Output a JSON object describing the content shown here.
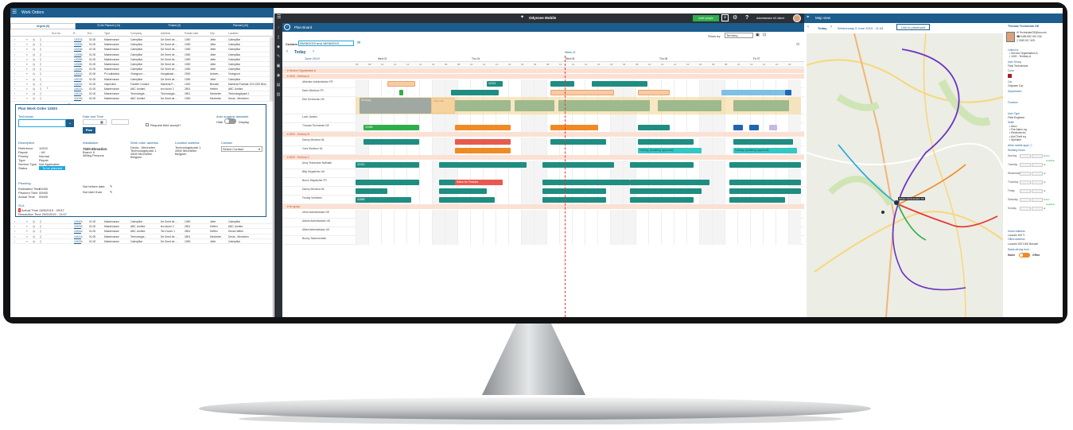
{
  "workorders": {
    "title": "Work Orders",
    "tabs": [
      "Urgent (0)",
      "To Be Planned (14)",
      "Posted (0)",
      "Planned (44)"
    ],
    "headers": [
      "SLA ris...",
      "R...",
      "Est...",
      "Type",
      "Company",
      "Address",
      "Postal code",
      "City",
      "Location"
    ],
    "rows_top": [
      {
        "id": "12021",
        "n": "1",
        "est": "01:00",
        "type": "Maintenance",
        "company": "Caterpillar",
        "address": "De Smet de ...",
        "postal": "1090",
        "city": "Jette",
        "location": "Caterpillar"
      },
      {
        "id": "12023",
        "n": "1",
        "est": "01:00",
        "type": "Maintenance",
        "company": "Caterpillar",
        "address": "De Smet de ...",
        "postal": "1090",
        "city": "Jette",
        "location": "Caterpillar"
      },
      {
        "id": "12024",
        "n": "1",
        "est": "01:00",
        "type": "Maintenance",
        "company": "Caterpillar",
        "address": "De Smet de ...",
        "postal": "1090",
        "city": "Jette",
        "location": "Caterpillar"
      },
      {
        "id": "12025",
        "n": "1",
        "est": "01:00",
        "type": "Maintenance",
        "company": "Caterpillar",
        "address": "De Smet de ...",
        "postal": "1090",
        "city": "Jette",
        "location": "Caterpillar"
      },
      {
        "id": "12026",
        "n": "1",
        "est": "01:00",
        "type": "Maintenance",
        "company": "Caterpillar",
        "address": "De Smet de ...",
        "postal": "1090",
        "city": "Jette",
        "location": "Caterpillar"
      },
      {
        "id": "12028",
        "n": "1",
        "est": "01:00",
        "type": "Maintenance",
        "company": "Caterpillar",
        "address": "De Smet de ...",
        "postal": "1090",
        "city": "Jette",
        "location": "Caterpillar"
      },
      {
        "id": "12029",
        "n": "1",
        "est": "01:00",
        "type": "Maintenance",
        "company": "Caterpillar",
        "address": "De Smet de ...",
        "postal": "1090",
        "city": "Jette",
        "location": "Caterpillar"
      },
      {
        "id": "12031",
        "n": "1",
        "est": "01:00",
        "type": "PV-validation",
        "company": "Vloeigroot ...",
        "address": "Hoogstraat ...",
        "postal": "2000",
        "city": "Antwer...",
        "location": "Vloeigroot"
      },
      {
        "id": "11923",
        "n": "1",
        "est": "01:00",
        "type": "Maintenance",
        "company": "Caterpillar",
        "address": "De Smet de ...",
        "postal": "1090",
        "city": "Jette",
        "location": "Caterpillar"
      },
      {
        "id": "11920",
        "n": "1",
        "est": "01:00",
        "type": "Inspection",
        "company": "Familie Cornard",
        "address": "Marnixla P...",
        "postal": "1000",
        "city": "Brussel",
        "location": "Marnixla Postrast 123 1000 Brus"
      },
      {
        "id": "11921",
        "n": "1",
        "est": "01:00",
        "type": "Maintenance",
        "company": "ABC Limited",
        "address": "ten doorn 2",
        "postal": "2801",
        "city": "Heffen",
        "location": "ABC Limited"
      },
      {
        "id": "11924",
        "n": "1",
        "est": "01:00",
        "type": "Maintenance",
        "company": "Technologie...",
        "address": "Technologie...",
        "postal": "2801",
        "city": "Mechelen",
        "location": "Technologiepark 1"
      },
      {
        "id": "11919",
        "n": "1",
        "est": "01:00",
        "type": "Maintenance",
        "company": "ABC Limited",
        "address": "De Smet de ...",
        "postal": "1090",
        "city": "Mechelen",
        "location": "Dexia - Mechelen"
      }
    ],
    "rows_bottom": [
      {
        "id": "11940",
        "n": "1",
        "est": "01:00",
        "type": "Maintenance",
        "company": "Caterpillar",
        "address": "De Smet de ...",
        "postal": "1090",
        "city": "Jette",
        "location": "Caterpillar"
      },
      {
        "id": "11943",
        "n": "1",
        "est": "01:00",
        "type": "Maintenance",
        "company": "ABC Limited",
        "address": "ten doorn 2",
        "postal": "2801",
        "city": "Heffen",
        "location": "ABC Limited"
      },
      {
        "id": "11944",
        "n": "1",
        "est": "01:00",
        "type": "Maintenance",
        "company": "ABC Limited",
        "address": "Ten Doorn 1",
        "postal": "2801",
        "city": "Heffen",
        "location": "Dexia Heffen"
      },
      {
        "id": "11941",
        "n": "1",
        "est": "01:00",
        "type": "Maintenance",
        "company": "Technologie...",
        "address": "De Smet de ...",
        "postal": "2801",
        "city": "Mechelen",
        "location": "Dexia - Mechelen"
      },
      {
        "id": "11933",
        "n": "1",
        "est": "01:00",
        "type": "Maintenance",
        "company": "Caterpillar",
        "address": "De Smet de ...",
        "postal": "1090",
        "city": "Jette",
        "location": "Caterpillar"
      }
    ],
    "plan": {
      "title": "Plan Work Order 11920",
      "technician_label": "Technician",
      "date_label": "Date and Time",
      "plan_button": "Plan",
      "request_accept": "Request field accept?",
      "auto_suggest": "Auto suggest assistant",
      "hide": "Hide",
      "display": "Display",
      "description": "Description",
      "fields": [
        {
          "k": "Reference",
          "v": "11920"
        },
        {
          "k": "Repair",
          "v": "- UK"
        },
        {
          "k": "Priority",
          "v": "Normal"
        },
        {
          "k": "Type",
          "v": "Repair"
        },
        {
          "k": "Service Type",
          "v": "Not Applicable"
        },
        {
          "k": "Status",
          "v": "To be planned"
        }
      ],
      "installation": "Installation",
      "installation_lines": [
        "7020 Elevation",
        "Brand: K",
        "489kg Persons"
      ],
      "wo_address": "Work order address",
      "wo_address_lines": [
        "Dexia - Mechelen",
        "Technologiepark 1",
        "2800 Mechelen",
        "Belgium"
      ],
      "loc_address": "Location address",
      "loc_address_lines": [
        "Technologiepark 1",
        "2800 Mechelen",
        "Belgium"
      ],
      "contact": "Contact",
      "contact_select": "Select Contact",
      "planning": "Planning",
      "planning_fields": [
        {
          "k": "Estimated Time",
          "v": "01h00"
        },
        {
          "k": "Planned Time",
          "v": "00h00"
        },
        {
          "k": "Actual Time",
          "v": "00h00"
        }
      ],
      "not_before": "Not before date",
      "not_later": "Not later than",
      "sla": "SLA",
      "sla_lines": [
        "Arrival Time  28/5/2019 - 09:57",
        "Resolution Time 29/5/2019 - 11:57"
      ]
    }
  },
  "odyssee": {
    "app_title": "Odyssee Mobile",
    "invite_button": "Invite people",
    "user": "Administrator UK Albert"
  },
  "planboard": {
    "title": "Plan Board",
    "show_by_label": "Show by",
    "show_by_value": "Territory",
    "custom_label": "Custom",
    "custom_range": "05/06/2019 and 18/06/2019",
    "today": "Today",
    "month": "June 2019",
    "week_label": "Week 21",
    "days": [
      "Wed 02",
      "Thu 04",
      "Wed 05",
      "Thu 06",
      "Fri 07"
    ],
    "hours": [
      "06",
      "08",
      "10",
      "12",
      "14",
      "16",
      "18",
      "06",
      "08",
      "10",
      "12",
      "14",
      "16",
      "18",
      "06",
      "08",
      "10",
      "12",
      "14",
      "16",
      "18",
      "06",
      "08",
      "10",
      "12",
      "14",
      "16",
      "18",
      "06",
      "08",
      "10",
      "12",
      "14",
      "16",
      "18"
    ],
    "groups": [
      {
        "label": "Service Organisation A",
        "rows": []
      },
      {
        "label": "1000 - Territory A",
        "rows": [
          "Albertine Administrator FR",
          "Dario Monteux FR",
          "Dirk Technician UK",
          "Ludo Jansen",
          "Thomas Technician DE"
        ]
      },
      {
        "label": "2000 - Territory B",
        "rows": [
          "Danny Monteux NL",
          "Yves Monteux NL"
        ]
      },
      {
        "label": "4000 - Territory C",
        "rows": [
          "Anny Technician Nathalie",
          "Billy Dispatcher UK",
          "Bruno Dispatcher FR",
          "Danny Monteux NL",
          "Freddy Verlinden"
        ]
      },
      {
        "label": "No group",
        "rows": [
          "Ulrich Administrator DE",
          "Adrian Administrator UK",
          "Albert Administrator UK",
          "Bonny Teammember"
        ]
      }
    ],
    "bar_labels": {
      "mon": "Monday",
      "daycall": "Day call",
      "holiday_approved": "Holiday (Awaiting approval)",
      "sales_prices": "Sales for Finance",
      "id11921": "11921",
      "id11945": "11945",
      "id11910": "11910",
      "id11883": "11883"
    }
  },
  "mapview": {
    "title": "Map view",
    "today": "Today",
    "date": "Wednesday 5 June 2019 - 11:34",
    "link": "Link to planboard",
    "technician": "Thomas Technician DE",
    "email": "TechnicianDE@sa.com",
    "phone1": "0495 652 422 234",
    "phone2": "0349 617 409",
    "marker": "Tobias Administrator FR",
    "linked_to": "Linked to",
    "linked_lines": [
      "Service Organisation A",
      "1000 - Territory A"
    ],
    "user_group": "User Group",
    "user_group_val": "Field Technicians",
    "color": "Color",
    "car": "Car",
    "car_val": "Odyssee Car",
    "department": "Department",
    "function": "Function",
    "user_type": "User Type",
    "user_type_val": "Field Engineer",
    "skills": "Skills",
    "skills_list": [
      "Airco",
      "Fire Alarm eg.",
      "Electrotechn.",
      "Anti Theft eq.",
      "Sprinkler"
    ],
    "allow_apps": "Allow mobile apps",
    "working_hours": "Working Hours",
    "days": [
      "Monday",
      "Tuesday",
      "Wednesday",
      "Thursday",
      "Friday",
      "Saturday",
      "Sunday"
    ],
    "not_available": "Not available",
    "home_address": "Home Address",
    "home_lines": [
      "Louvain 105",
      "Louvain 105 1000 Brussel"
    ],
    "office_address": "Office Address",
    "starts_from": "Starts driving from",
    "home": "Home",
    "office": "Office"
  },
  "colors": {
    "header": "#1c5d8e",
    "accent": "#1fa8e0",
    "teal": "#1f8d81",
    "red_line": "#e53935"
  }
}
